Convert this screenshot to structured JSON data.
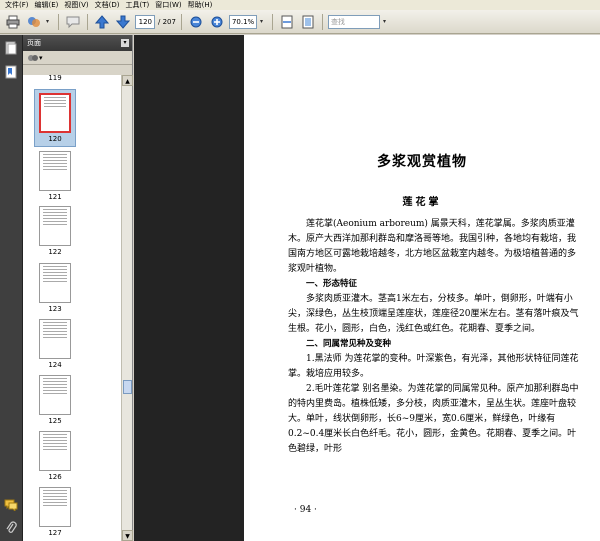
{
  "menu": [
    "文件(F)",
    "编辑(E)",
    "视图(V)",
    "文档(D)",
    "工具(T)",
    "窗口(W)",
    "帮助(H)"
  ],
  "toolbar": {
    "page_current": "120",
    "page_total": "/ 207",
    "zoom": "70.1%",
    "search_placeholder": "查找"
  },
  "panel": {
    "title": "页面",
    "options_label": "▾"
  },
  "thumbnails": [
    {
      "label": "119"
    },
    {
      "label": "120"
    },
    {
      "label": "121"
    },
    {
      "label": "122"
    },
    {
      "label": "123"
    },
    {
      "label": "124"
    },
    {
      "label": "125"
    },
    {
      "label": "126"
    },
    {
      "label": "127"
    }
  ],
  "page": {
    "title": "多浆观赏植物",
    "subtitle": "莲花掌",
    "paragraphs": [
      {
        "type": "p",
        "text": "莲花掌(Aeonium arboreum) 属景天科，莲花掌属。多浆肉质亚灌木。原产大西洋加那利群岛和摩洛哥等地。我国引种，各地均有栽培，我国南方地区可露地栽培越冬，北方地区盆栽室内越冬。为极培植普通的多浆观叶植物。"
      },
      {
        "type": "sec",
        "text": "一、形态特征"
      },
      {
        "type": "p",
        "text": "多浆肉质亚灌木。茎高1米左右，分枝多。单叶，倒卵形，叶端有小尖，深绿色，丛生枝顶端呈莲座状，莲座径20厘米左右。茎有落叶痕及气生根。花小，圆形，白色，浅红色或红色。花期春、夏季之间。"
      },
      {
        "type": "sec",
        "text": "二、同属常见种及变种"
      },
      {
        "type": "p",
        "text": "1.黑法师 为莲花掌的变种。叶深紫色，有光泽，其他形状特征同莲花掌。栽培应用较多。"
      },
      {
        "type": "p",
        "text": "2.毛叶莲花掌 别名墨染。为莲花掌的同属常见种。原产加那利群岛中的特内里费岛。植株低矮，多分枝，肉质亚灌木，呈丛生状。莲座叶盘较大。单叶，线状倒卵形，长6~9厘米，宽0.6厘米，鲜绿色，叶缘有0.2~0.4厘米长白色纤毛。花小，圆形，金黄色。花期春、夏季之间。叶色碧绿，叶形"
      }
    ],
    "page_number": "· 94 ·"
  }
}
